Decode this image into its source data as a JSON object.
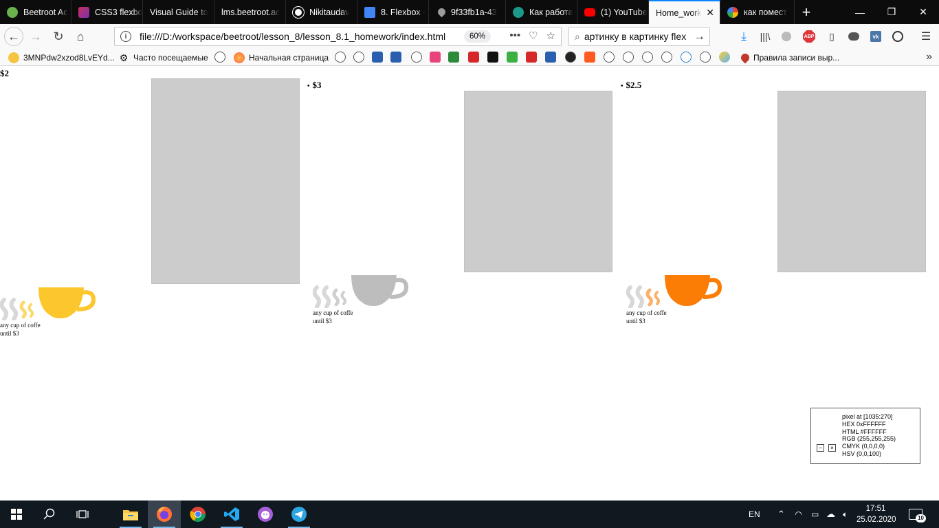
{
  "browser": {
    "tabs": [
      {
        "label": "Beetroot Ac",
        "icon": "beetroot-icon",
        "color": "#6ab04c"
      },
      {
        "label": "CSS3 flexbo",
        "icon": "css-icon",
        "color": "#c8305c"
      },
      {
        "label": "Visual Guide to",
        "icon": "none",
        "color": "#0c0c0d"
      },
      {
        "label": "lms.beetroot.ac",
        "icon": "none",
        "color": "#0c0c0d"
      },
      {
        "label": "Nikitaudav",
        "icon": "github-icon",
        "color": "#ffffff"
      },
      {
        "label": "8. Flexbox -",
        "icon": "docs-icon",
        "color": "#4285f4"
      },
      {
        "label": "9f33fb1a-43",
        "icon": "drop-icon",
        "color": "#9c9c9c"
      },
      {
        "label": "Как работа",
        "icon": "site-icon",
        "color": "#1a9b8a"
      },
      {
        "label": "(1) YouTube",
        "icon": "youtube-icon",
        "color": "#ff0000"
      },
      {
        "label": "Home_work",
        "icon": "none",
        "color": "#0c0c0d",
        "active": true
      },
      {
        "label": "как помест",
        "icon": "google-icon",
        "color": "#4285f4"
      }
    ],
    "url": "file:///D:/workspace/beetroot/lesson_8/lesson_8.1_homework/index.html",
    "zoom": "60%",
    "search_text": "артинку в картинку flex",
    "bookmarks": {
      "first": "3MNPdw2xzod8LvEYd...",
      "most_visited": "Часто посещаемые",
      "home": "Начальная страница",
      "last": "Правила записи выр..."
    },
    "abp_badge": "ABP"
  },
  "page": {
    "items": [
      {
        "price": "$2",
        "bullet": false,
        "caption_line1": "any cup of coffe",
        "caption_line2": "until $3",
        "cup_color": "#fcc72c",
        "steam_color": "#fcd86a"
      },
      {
        "price": "$3",
        "bullet": true,
        "caption_line1": "any cup of coffe",
        "caption_line2": "until $3",
        "cup_color": "#bdbdbd",
        "steam_color": "#cfcfcf"
      },
      {
        "price": "$2.5",
        "bullet": true,
        "caption_line1": "any cup of coffe",
        "caption_line2": "until $3",
        "cup_color": "#fb7d06",
        "steam_color": "#fbb06a"
      }
    ],
    "placeholder_color": "#cccccc"
  },
  "color_picker": {
    "line1": "pixel at [1035:270]",
    "line2": "HEX 0xFFFFFF",
    "line3": "HTML #FFFFFF",
    "line4": "RGB (255,255,255)",
    "line5": "CMYK (0,0,0,0)",
    "line6": "HSV (0,0,100)",
    "minimize": "–",
    "close": "×"
  },
  "taskbar": {
    "language": "EN",
    "time": "17:51",
    "date": "25.02.2020",
    "notifications": "10"
  }
}
